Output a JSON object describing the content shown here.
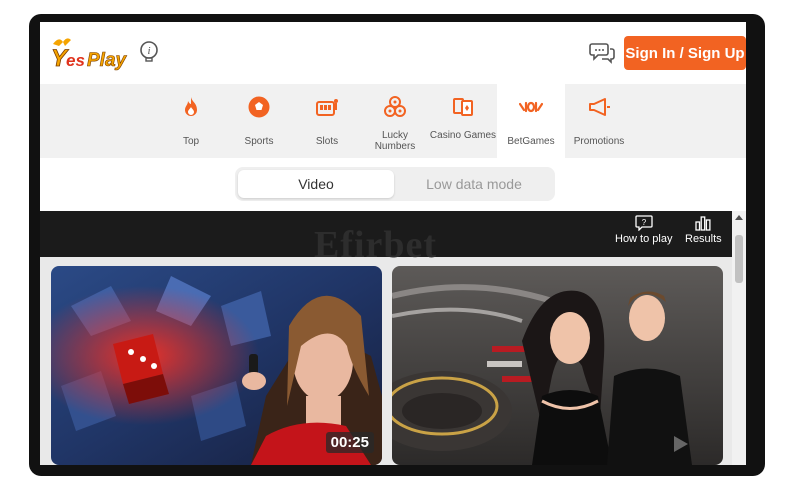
{
  "header": {
    "logo_text": "YesPlay",
    "sign_in_label": "Sign In / Sign Up"
  },
  "nav": {
    "items": [
      {
        "label": "Top",
        "icon": "fire-icon"
      },
      {
        "label": "Sports",
        "icon": "soccer-ball-icon"
      },
      {
        "label": "Slots",
        "icon": "slot-machine-icon"
      },
      {
        "label": "Lucky Numbers",
        "icon": "lottery-balls-icon"
      },
      {
        "label": "Casino Games",
        "icon": "cards-icon"
      },
      {
        "label": "BetGames",
        "icon": "betgames-icon"
      },
      {
        "label": "Promotions",
        "icon": "megaphone-icon"
      }
    ],
    "active": "BetGames"
  },
  "view_toggle": {
    "video": "Video",
    "low_data": "Low data mode",
    "selected": "Video"
  },
  "game_bar": {
    "watermark": "Efirbet",
    "how_to_play": "How to play",
    "results": "Results"
  },
  "tiles": [
    {
      "name": "dice-game",
      "timer": "00:25"
    },
    {
      "name": "wheel-game",
      "timer": ""
    }
  ],
  "colors": {
    "accent": "#f26322",
    "nav_bg": "#f1f1f1",
    "bar_bg": "#1b1b1b"
  }
}
